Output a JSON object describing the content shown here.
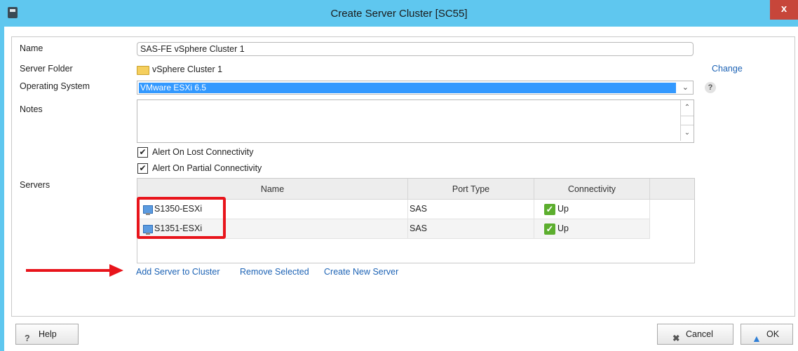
{
  "window": {
    "title": "Create Server Cluster [SC55]",
    "close_label": "x"
  },
  "form": {
    "name_label": "Name",
    "name_value": "SAS-FE vSphere Cluster 1",
    "folder_label": "Server Folder",
    "folder_value": "vSphere Cluster 1",
    "change_link": "Change",
    "os_label": "Operating System",
    "os_value": "VMware ESXi 6.5",
    "help_glyph": "?",
    "notes_label": "Notes",
    "notes_value": "",
    "alert_lost_label": "Alert On Lost Connectivity",
    "alert_lost_checked": true,
    "alert_partial_label": "Alert On Partial Connectivity",
    "alert_partial_checked": true,
    "servers_label": "Servers"
  },
  "servers_table": {
    "columns": [
      "Name",
      "Port Type",
      "Connectivity"
    ],
    "rows": [
      {
        "name": "S1350-ESXi",
        "port_type": "SAS",
        "connectivity": "Up"
      },
      {
        "name": "S1351-ESXi",
        "port_type": "SAS",
        "connectivity": "Up"
      }
    ]
  },
  "actions": {
    "add_server": "Add Server to Cluster",
    "remove_selected": "Remove Selected",
    "create_new_server": "Create New Server"
  },
  "footer": {
    "help": "Help",
    "cancel": "Cancel",
    "ok": "OK"
  },
  "icons": [
    "app-icon",
    "folder-icon",
    "server-icon",
    "status-up-icon",
    "help-icon",
    "cancel-icon",
    "ok-arrow-icon",
    "chevron-down-icon"
  ],
  "colors": {
    "titlebar": "#5fc7ef",
    "selection": "#3399ff",
    "link": "#1d63b5",
    "annotation_red": "#e8141b",
    "status_up": "#5cae2e"
  }
}
